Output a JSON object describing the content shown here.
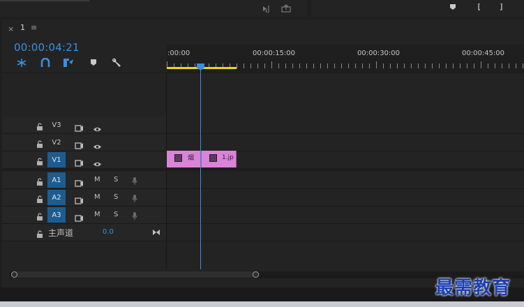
{
  "panel": {
    "close": "×",
    "title": "1",
    "menu": "≡"
  },
  "timecode": "00:00:04:21",
  "ruler": {
    "labels": [
      ":00:00",
      "00:00:15:00",
      "00:00:30:00",
      "00:00:45:00"
    ]
  },
  "tracks": {
    "video": [
      {
        "label": "V3",
        "targeted": false
      },
      {
        "label": "V2",
        "targeted": false
      },
      {
        "label": "V1",
        "targeted": true
      }
    ],
    "audio": [
      {
        "label": "A1",
        "mute": "M",
        "solo": "S"
      },
      {
        "label": "A2",
        "mute": "M",
        "solo": "S"
      },
      {
        "label": "A3",
        "mute": "M",
        "solo": "S"
      }
    ],
    "master": {
      "label": "主声道",
      "value": "0.0"
    }
  },
  "clips": [
    {
      "name": "烟"
    },
    {
      "name": "1.jp"
    }
  ],
  "watermark": "最需教育",
  "colors": {
    "accent": "#3b8fe0",
    "target": "#1d5c91",
    "clip": "#d984d8",
    "work_area": "#e8d520"
  }
}
